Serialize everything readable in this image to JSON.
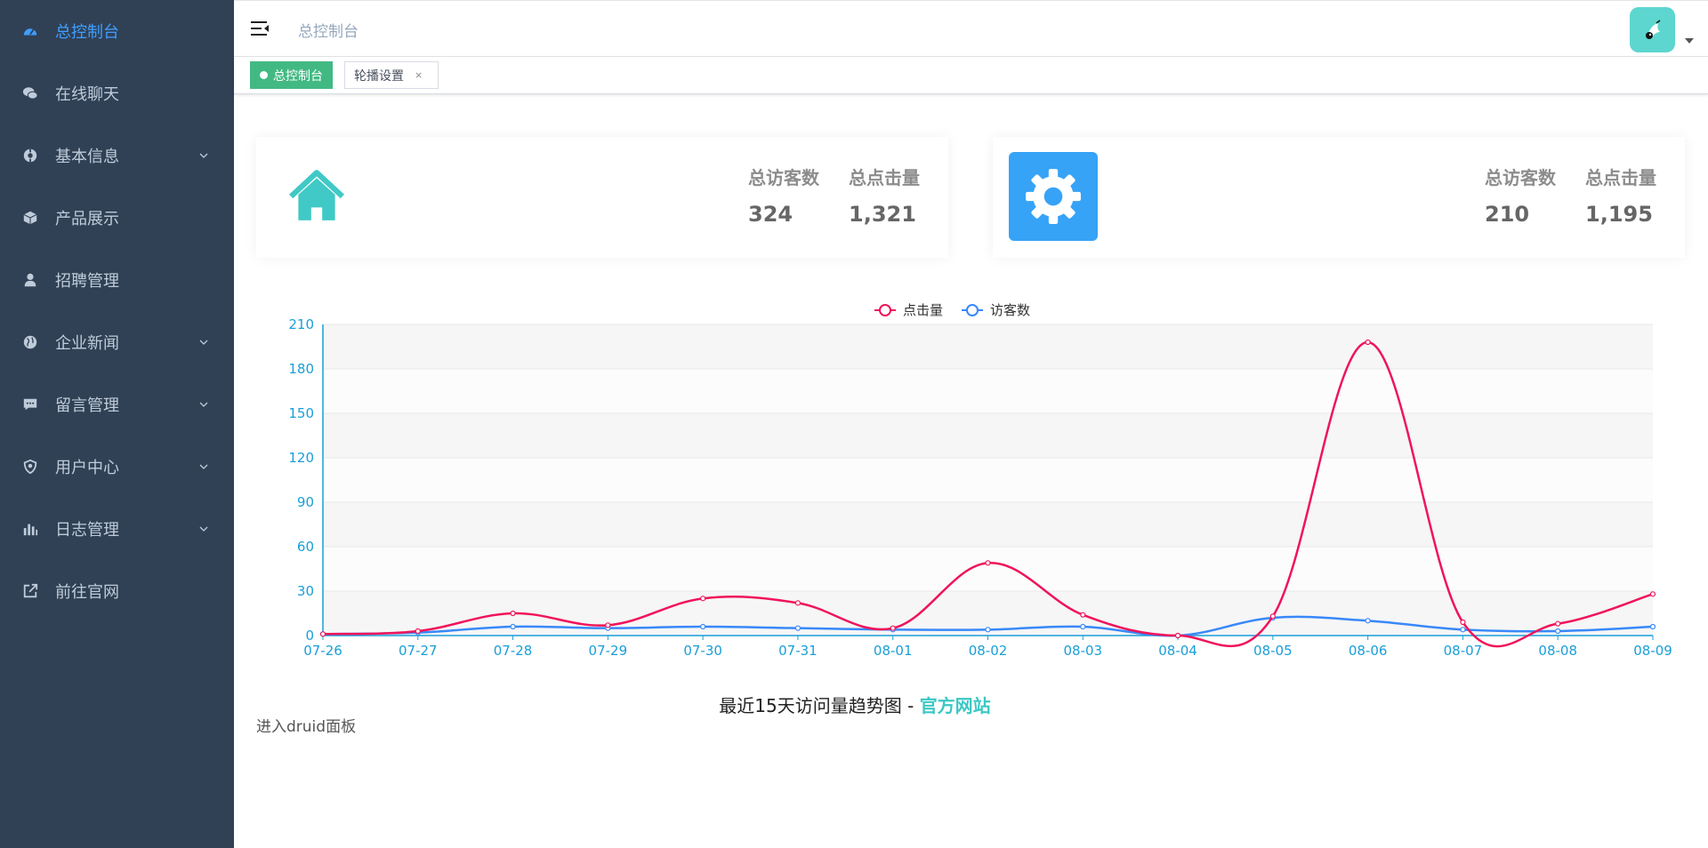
{
  "sidebar": {
    "items": [
      {
        "label": "总控制台",
        "icon": "dashboard-icon",
        "has_submenu": false,
        "active": true
      },
      {
        "label": "在线聊天",
        "icon": "chat-icon",
        "has_submenu": false
      },
      {
        "label": "基本信息",
        "icon": "info-icon",
        "has_submenu": true
      },
      {
        "label": "产品展示",
        "icon": "box-icon",
        "has_submenu": false
      },
      {
        "label": "招聘管理",
        "icon": "user-icon",
        "has_submenu": false
      },
      {
        "label": "企业新闻",
        "icon": "globe-icon",
        "has_submenu": true
      },
      {
        "label": "留言管理",
        "icon": "message-icon",
        "has_submenu": true
      },
      {
        "label": "用户中心",
        "icon": "shield-icon",
        "has_submenu": true
      },
      {
        "label": "日志管理",
        "icon": "bar-chart-icon",
        "has_submenu": true
      },
      {
        "label": "前往官网",
        "icon": "external-link-icon",
        "has_submenu": false
      }
    ]
  },
  "header": {
    "breadcrumb": "总控制台"
  },
  "tags": [
    {
      "label": "总控制台",
      "active": true
    },
    {
      "label": "轮播设置",
      "active": false,
      "close": "×"
    }
  ],
  "panels": [
    {
      "icon": "home-icon",
      "color": "#40c9c6",
      "stats": [
        {
          "label": "总访客数",
          "value": "324"
        },
        {
          "label": "总点击量",
          "value": "1,321"
        }
      ]
    },
    {
      "icon": "gear-icon",
      "color": "#36a3f7",
      "stats": [
        {
          "label": "总访客数",
          "value": "210"
        },
        {
          "label": "总点击量",
          "value": "1,195"
        }
      ]
    }
  ],
  "chart_data": {
    "type": "line",
    "categories": [
      "07-26",
      "07-27",
      "07-28",
      "07-29",
      "07-30",
      "07-31",
      "08-01",
      "08-02",
      "08-03",
      "08-04",
      "08-05",
      "08-06",
      "08-07",
      "08-08",
      "08-09"
    ],
    "series": [
      {
        "name": "点击量",
        "color": "#f0145a",
        "values": [
          1,
          3,
          15,
          7,
          25,
          22,
          5,
          49,
          14,
          0,
          13,
          198,
          9,
          8,
          28
        ]
      },
      {
        "name": "访客数",
        "color": "#3888fa",
        "values": [
          1,
          2,
          6,
          5,
          6,
          5,
          4,
          4,
          6,
          0,
          12,
          10,
          4,
          3,
          6
        ]
      }
    ],
    "ylim": [
      0,
      210
    ],
    "yticks": [
      0,
      30,
      60,
      90,
      120,
      150,
      180,
      210
    ],
    "legend_position": "top-center",
    "grid": true
  },
  "chart_caption": {
    "prefix": "最近15天访问量趋势图 - ",
    "link": "官方网站"
  },
  "druid_link": "进入druid面板"
}
